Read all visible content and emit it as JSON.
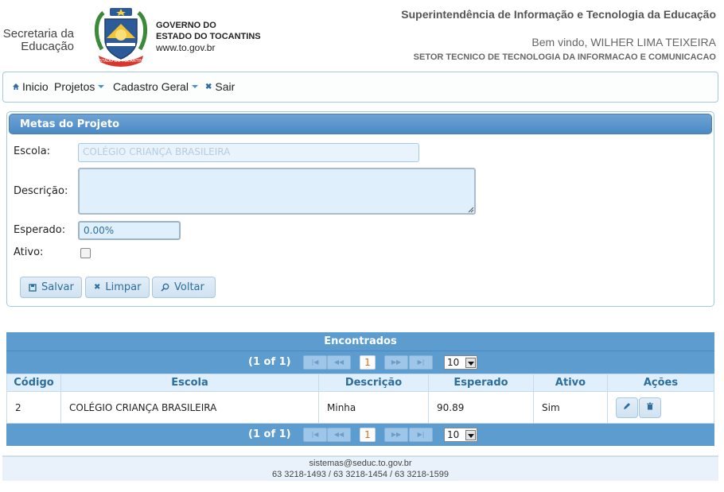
{
  "header": {
    "secretaria_line1": "Secretaria da",
    "secretaria_line2": "Educação",
    "seal_text": "ESTADO DO TOCANTINS",
    "gov_line1": "GOVERNO DO",
    "gov_line2": "ESTADO DO TOCANTINS",
    "gov_site": "www.to.gov.br",
    "title": "Superintendência de Informação e Tecnologia da Educação",
    "welcome": "Bem vindo, WILHER LIMA TEIXEIRA",
    "setor": "SETOR TECNICO DE TECNOLOGIA DA INFORMACAO E COMUNICACAO"
  },
  "menu": {
    "inicio": "Inicio",
    "projetos": "Projetos",
    "cadastro_geral": "Cadastro Geral",
    "sair": "Sair"
  },
  "form": {
    "panel_title": "Metas do Projeto",
    "escola_label": "Escola:",
    "escola_value": "COLÉGIO CRIANÇA BRASILEIRA",
    "descricao_label": "Descrição:",
    "descricao_value": "",
    "esperado_label": "Esperado:",
    "esperado_value": "0.00%",
    "ativo_label": "Ativo:",
    "ativo_checked": false,
    "salvar": "Salvar",
    "limpar": "Limpar",
    "voltar": "Voltar"
  },
  "results": {
    "title": "Encontrados",
    "page_info": "(1 of 1)",
    "current_page": "1",
    "rows_per_page": "10",
    "columns": [
      "Código",
      "Escola",
      "Descrição",
      "Esperado",
      "Ativo",
      "Ações"
    ],
    "rows": [
      {
        "codigo": "2",
        "escola": "COLÉGIO CRIANÇA BRASILEIRA",
        "descricao": "Minha",
        "esperado": "90.89",
        "ativo": "Sim"
      }
    ]
  },
  "footer": {
    "email": "sistemas@seduc.to.gov.br",
    "phones": "63 3218-1493 / 63 3218-1454 / 63 3218-1599"
  },
  "colors": {
    "accent": "#5c9ccf",
    "header_bar": "#4b8ac6",
    "input_bg": "#dfeffc",
    "page_highlight": "#e06b12"
  }
}
